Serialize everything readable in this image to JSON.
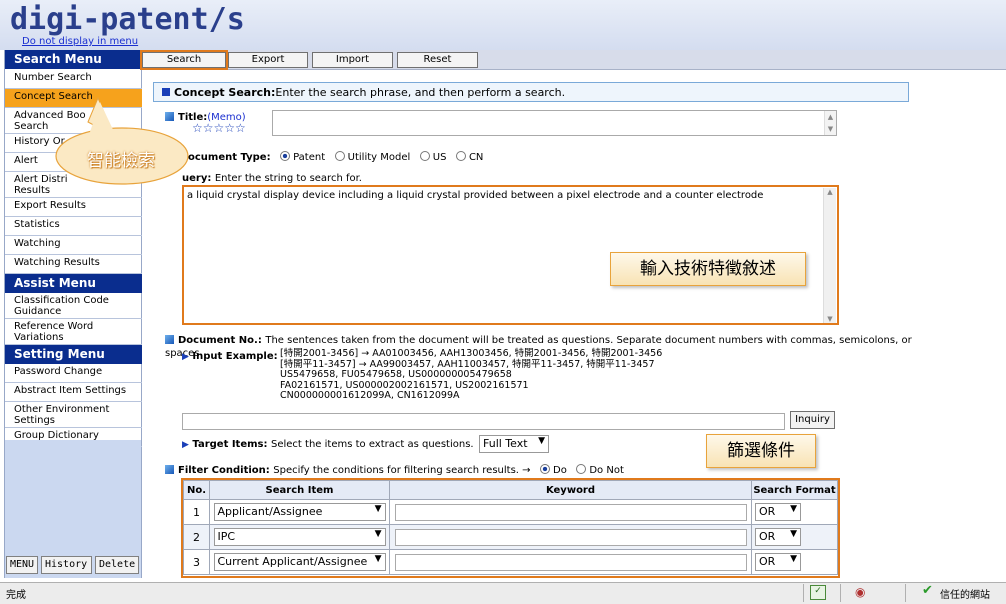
{
  "header": {
    "logo": "digi-patent/s",
    "hide_link": "Do not display in menu"
  },
  "sidebar": {
    "search_menu_title": "Search Menu",
    "search_items": [
      "Number Search",
      "Concept Search",
      "Advanced Boolean Search",
      "History Or",
      "Alert",
      "Alert Distribution Results",
      "Export Results",
      "Statistics",
      "Watching",
      "Watching Results"
    ],
    "search_items_display": [
      "Number Search",
      "Concept Search",
      "Advanced Boo",
      "Search",
      "History Or",
      "Alert",
      "Alert Distri",
      "Results",
      "Export Results",
      "Statistics",
      "Watching",
      "Watching Results"
    ],
    "assist_menu_title": "Assist Menu",
    "assist_items": [
      "Classification Code",
      "Guidance",
      "Reference Word",
      "Variations"
    ],
    "setting_menu_title": "Setting Menu",
    "setting_items": [
      "Password Change",
      "Abstract Item Settings",
      "Other Environment",
      "Settings",
      "Group Dictionary"
    ],
    "bottom_buttons": [
      "MENU",
      "History",
      "Delete"
    ]
  },
  "toolbar": {
    "search": "Search",
    "export": "Export",
    "import": "Import",
    "reset": "Reset"
  },
  "concept": {
    "bar_title": "Concept Search:",
    "bar_text": "Enter the search phrase, and then perform a search.",
    "title_label": "Title:",
    "memo": "(Memo)",
    "stars": "☆☆☆☆☆",
    "doctype_label": "ocument Type:",
    "doctypes": [
      "Patent",
      "Utility Model",
      "US",
      "CN"
    ],
    "query_label": "uery:",
    "query_note": "Enter the string to search for.",
    "query_value": "a liquid crystal display device including a liquid crystal provided between a pixel electrode and a counter electrode",
    "docno_label": "Document No.:",
    "docno_note": "The sentences taken from the document will be treated as questions. Separate document numbers with commas, semicolons, or spaces.",
    "input_example_label": "Input Example:",
    "input_example_lines": [
      "[特開2001-3456] → AA01003456, AAH13003456, 特開2001-3456, 特開2001-3456",
      "[特開平11-3457] → AA99003457, AAH11003457, 特開平11-3457, 特開平11-3457",
      "US5479658, FU05479658, US000000005479658",
      "FA02161571, US000002002161571, US2002161571",
      "CN000000001612099A, CN1612099A"
    ],
    "inquiry_button": "Inquiry",
    "target_label": "Target Items:",
    "target_note": "Select the items to extract as questions.",
    "target_value": "Full Text",
    "filter_label": "Filter Condition:",
    "filter_note": "Specify the conditions for filtering search results. →",
    "filter_options": [
      "Do",
      "Do Not"
    ]
  },
  "filter_table": {
    "headers": [
      "No.",
      "Search Item",
      "Keyword",
      "Search Format"
    ],
    "rows": [
      {
        "no": "1",
        "item": "Applicant/Assignee",
        "keyword": "",
        "format": "OR"
      },
      {
        "no": "2",
        "item": "IPC",
        "keyword": "",
        "format": "OR"
      },
      {
        "no": "3",
        "item": "Current Applicant/Assignee",
        "keyword": "",
        "format": "OR"
      }
    ]
  },
  "callouts": {
    "smart_search": "智能檢索",
    "input_desc": "輸入技術特徵敘述",
    "filter": "篩選條件"
  },
  "statusbar": {
    "status": "完成",
    "zone": "信任的網站"
  }
}
